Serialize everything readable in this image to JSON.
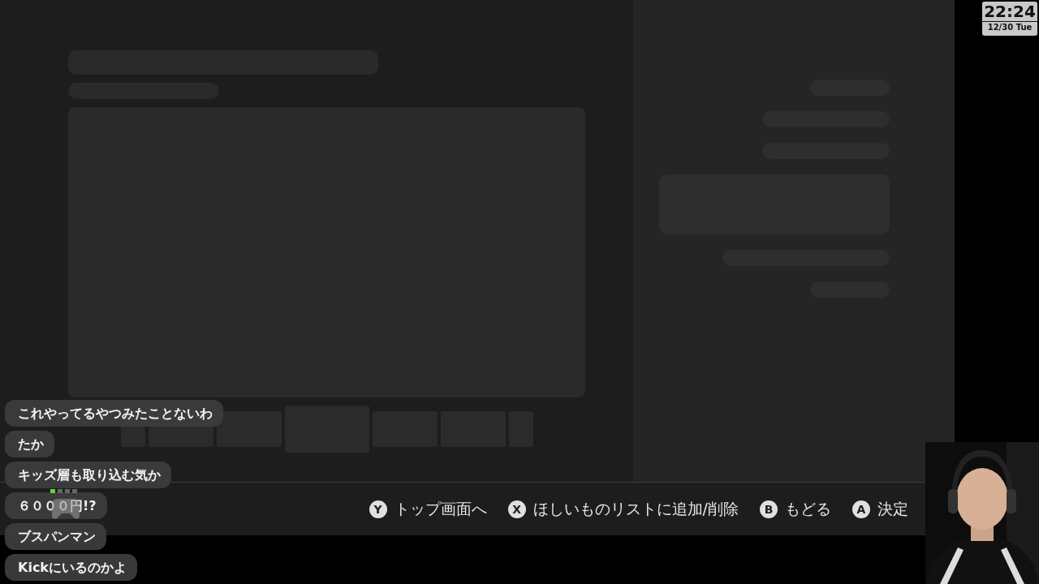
{
  "clock": {
    "time": "22:24",
    "date": "12/30 Tue"
  },
  "hints": [
    {
      "button": "Y",
      "label": "トップ画面へ"
    },
    {
      "button": "X",
      "label": "ほしいものリストに追加/削除"
    },
    {
      "button": "B",
      "label": "もどる"
    },
    {
      "button": "A",
      "label": "決定"
    }
  ],
  "chat": [
    {
      "text": "これやってるやつみたことないわ"
    },
    {
      "text": "たか"
    },
    {
      "text": "キッズ層も取り込む気か"
    },
    {
      "text": "６０００円!?"
    },
    {
      "text": "ブスパンマン"
    },
    {
      "text": "Kickにいるのかよ"
    }
  ]
}
